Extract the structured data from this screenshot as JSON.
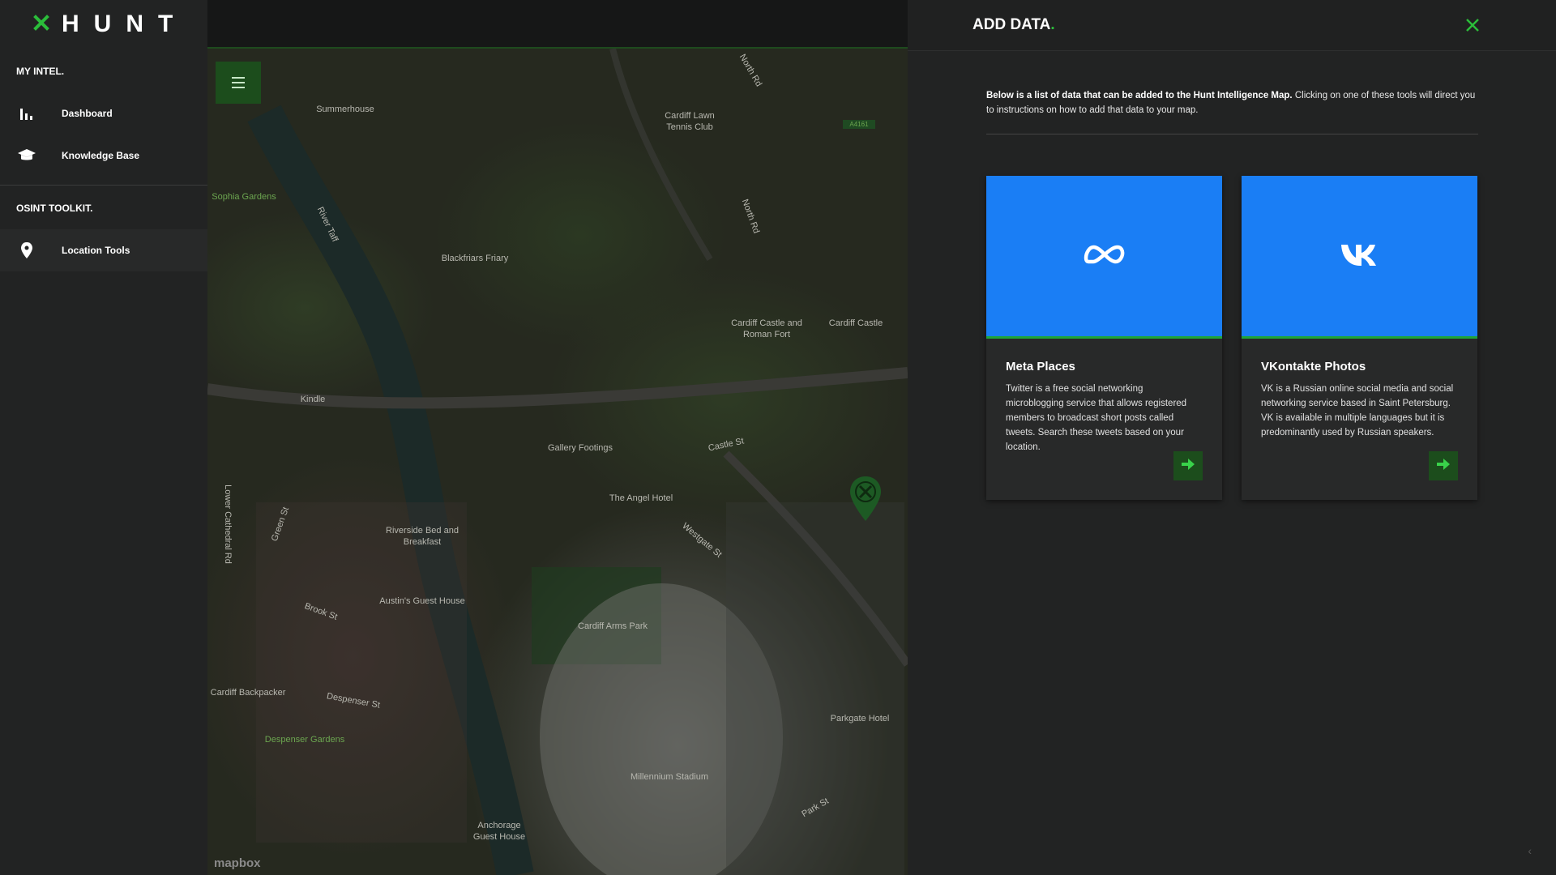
{
  "app": {
    "logo_text": "HUNT",
    "accent": "#2bbd3a"
  },
  "sidebar": {
    "sections": [
      {
        "title": "MY INTEL.",
        "items": [
          {
            "label": "Dashboard",
            "icon": "bar-chart-icon"
          },
          {
            "label": "Knowledge Base",
            "icon": "graduation-cap-icon"
          }
        ]
      },
      {
        "title": "OSINT TOOLKIT.",
        "items": [
          {
            "label": "Location Tools",
            "icon": "map-pin-icon"
          }
        ]
      }
    ]
  },
  "map": {
    "attribution": "mapbox",
    "labels": [
      "Summerhouse",
      "Sophia Gardens",
      "River Taff",
      "Blackfriars Friary",
      "Cardiff Lawn Tennis Club",
      "North Rd",
      "Cardiff Castle and Roman Fort",
      "Cardiff Castle",
      "Kindle",
      "Gallery Footings",
      "Castle St",
      "The Angel Hotel",
      "Westgate St",
      "Riverside Bed and Breakfast",
      "Austin's Guest House",
      "Brook St",
      "Cardiff Arms Park",
      "Lower Cathedral Rd",
      "Green St",
      "Cardiff Backpacker",
      "Despenser St",
      "Despenser Gardens",
      "Millennium Stadium",
      "Parkgate Hotel",
      "Anchorage Guest House",
      "Park St",
      "A4161"
    ]
  },
  "panel": {
    "title": "ADD DATA",
    "title_dot": ".",
    "intro_bold": "Below is a list of data that can be added to the Hunt Intelligence Map.",
    "intro_rest": " Clicking on one of these tools will direct you to instructions on how to add that data to your map.",
    "cards": [
      {
        "title": "Meta Places",
        "icon": "meta-logo-icon",
        "description": "Twitter is a free social networking microblogging service that allows registered members to broadcast short posts called tweets. Search these tweets based on your location."
      },
      {
        "title": "VKontakte Photos",
        "icon": "vk-logo-icon",
        "description": "VK is a Russian online social media and social networking service based in Saint Petersburg. VK is available in multiple languages but it is predominantly used by Russian speakers."
      }
    ]
  }
}
